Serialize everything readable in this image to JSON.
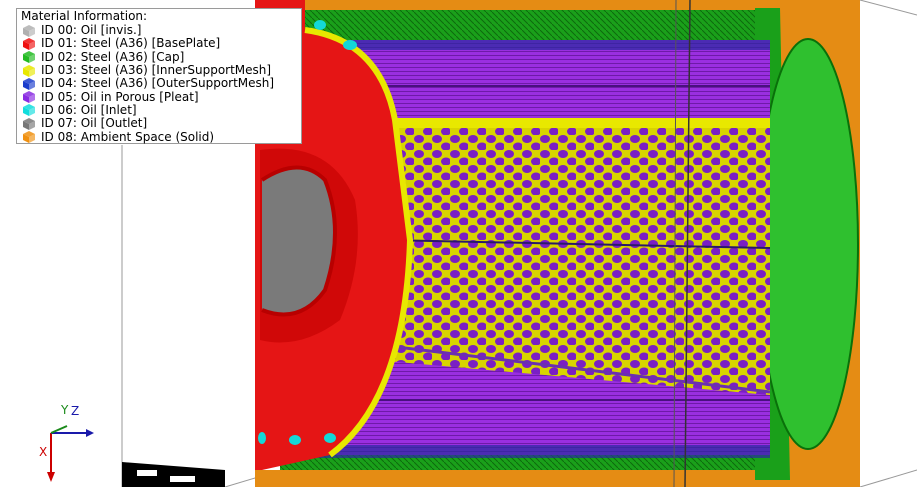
{
  "legend": {
    "title": "Material Information:",
    "items": [
      {
        "label": "ID 00: Oil [invis.]",
        "color": "#b0b0b0",
        "icon": "gray-cube-icon"
      },
      {
        "label": "ID 01: Steel (A36) [BasePlate]",
        "color": "#ee1111",
        "icon": "red-cube-icon"
      },
      {
        "label": "ID 02: Steel (A36) [Cap]",
        "color": "#22bb22",
        "icon": "green-cube-icon"
      },
      {
        "label": "ID 03: Steel (A36) [InnerSupportMesh]",
        "color": "#e8e800",
        "icon": "yellow-cube-icon"
      },
      {
        "label": "ID 04: Steel (A36) [OuterSupportMesh]",
        "color": "#1a3ccc",
        "icon": "blue-cube-icon"
      },
      {
        "label": "ID 05: Oil in Porous [Pleat]",
        "color": "#8a2be2",
        "icon": "purple-cube-icon"
      },
      {
        "label": "ID 06: Oil [Inlet]",
        "color": "#11dddd",
        "icon": "cyan-cube-icon"
      },
      {
        "label": "ID 07: Oil [Outlet]",
        "color": "#777777",
        "icon": "dark-gray-cube-icon"
      },
      {
        "label": "ID 08: Ambient Space (Solid)",
        "color": "#f09010",
        "icon": "orange-cube-icon"
      }
    ]
  },
  "axes": {
    "x_label": "X",
    "y_label": "Y",
    "z_label": "Z"
  }
}
